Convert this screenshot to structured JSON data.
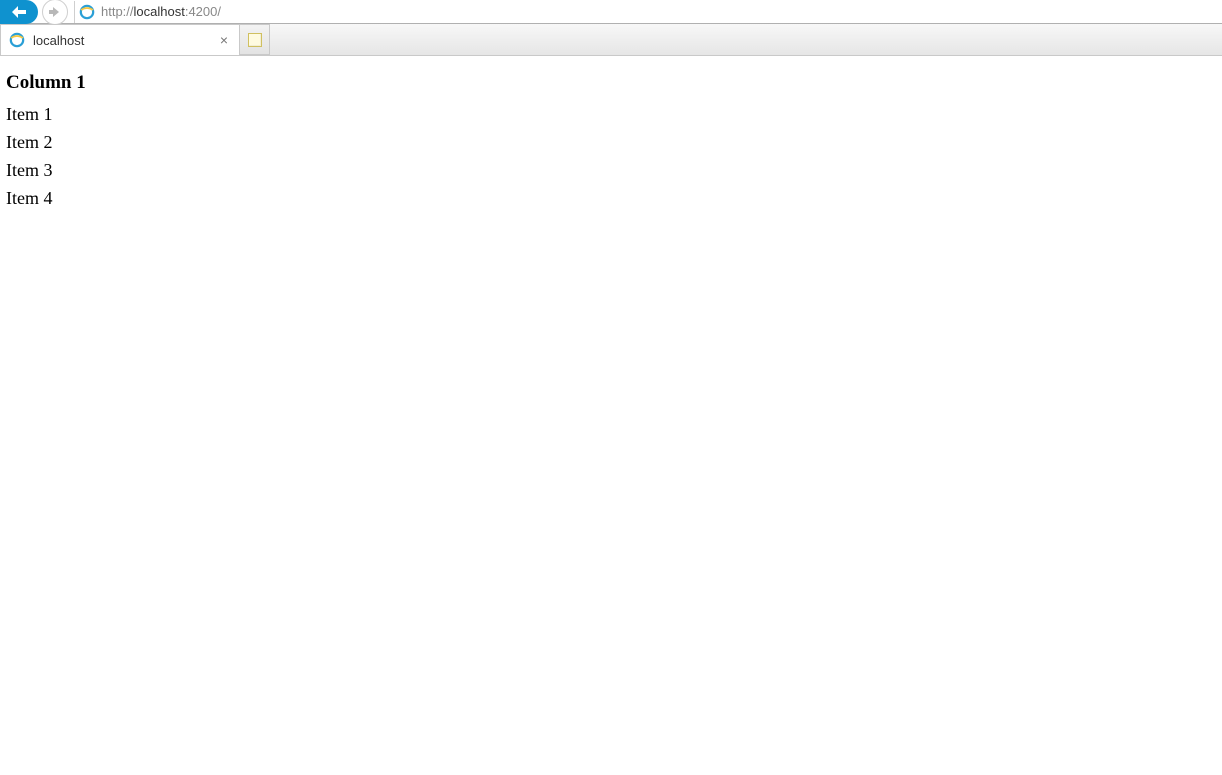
{
  "address_bar": {
    "url_prefix": "http://",
    "url_host": "localhost",
    "url_suffix": ":4200/"
  },
  "tab": {
    "title": "localhost"
  },
  "content": {
    "heading": "Column 1",
    "items": [
      "Item 1",
      "Item 2",
      "Item 3",
      "Item 4"
    ]
  }
}
